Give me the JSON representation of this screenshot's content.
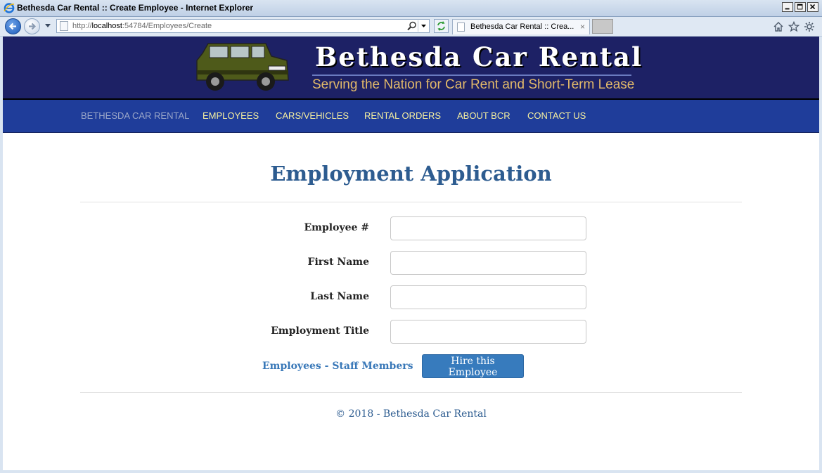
{
  "window": {
    "title": "Bethesda Car Rental :: Create Employee - Internet Explorer"
  },
  "browser": {
    "url_prefix": "http://",
    "url_host": "localhost",
    "url_rest": ":54784/Employees/Create",
    "tab_title": "Bethesda Car Rental :: Crea...",
    "tab_close": "×",
    "icons": [
      "back-icon",
      "forward-icon",
      "search-icon",
      "refresh-icon",
      "home-icon",
      "favorites-icon",
      "tools-icon"
    ]
  },
  "site": {
    "title": "Bethesda Car Rental",
    "tagline": "Serving the Nation for Car Rent and Short-Term Lease",
    "colors": {
      "banner": "#1d2165",
      "menu": "#1f3d9a",
      "menu_text": "#f5efa0",
      "heading": "#2d5c90"
    }
  },
  "menu": {
    "brand": "BETHESDA CAR RENTAL",
    "items": [
      "EMPLOYEES",
      "CARS/VEHICLES",
      "RENTAL ORDERS",
      "ABOUT BCR",
      "CONTACT US"
    ]
  },
  "form": {
    "heading": "Employment Application",
    "fields": [
      {
        "label": "Employee #",
        "value": ""
      },
      {
        "label": "First Name",
        "value": ""
      },
      {
        "label": "Last Name",
        "value": ""
      },
      {
        "label": "Employment Title",
        "value": ""
      }
    ],
    "link_label": "Employees - Staff Members",
    "submit_label": "Hire this Employee"
  },
  "footer": {
    "text": "© 2018 - Bethesda Car Rental"
  }
}
